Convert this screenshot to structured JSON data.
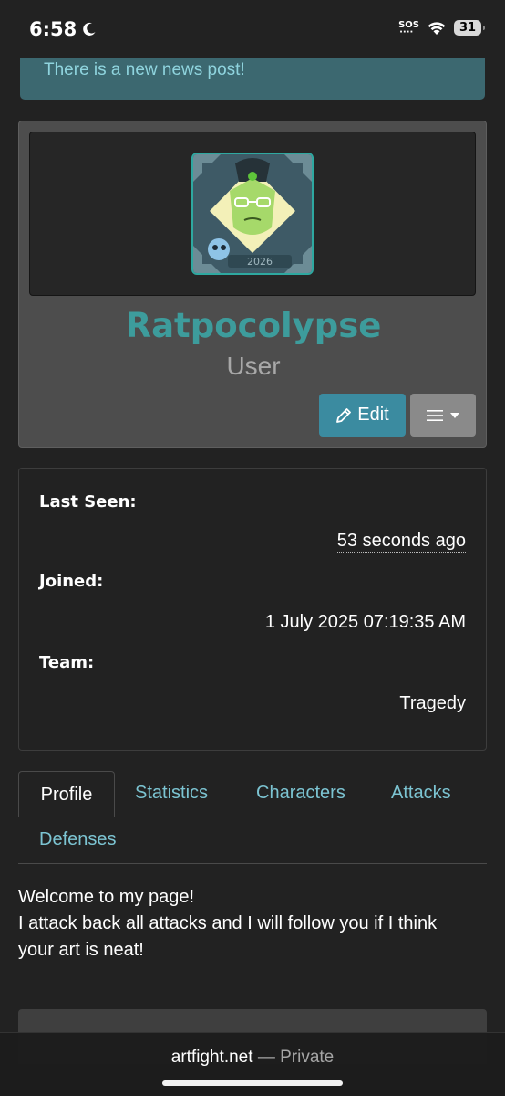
{
  "status_bar": {
    "time": "6:58",
    "sos": "SOS",
    "battery": "31"
  },
  "news": {
    "text": "There is a new news post!"
  },
  "profile": {
    "username": "Ratpocolypse",
    "role": "User",
    "edit_label": "Edit",
    "avatar_year": "2026"
  },
  "info": {
    "last_seen_label": "Last Seen:",
    "last_seen_value": "53 seconds ago",
    "joined_label": "Joined:",
    "joined_value": "1 July 2025 07:19:35 AM",
    "team_label": "Team:",
    "team_value": "Tragedy"
  },
  "tabs": [
    {
      "label": "Profile",
      "active": true
    },
    {
      "label": "Statistics"
    },
    {
      "label": "Characters"
    },
    {
      "label": "Attacks"
    },
    {
      "label": "Defenses"
    }
  ],
  "about": {
    "line1": "Welcome to my page!",
    "line2": "I attack back all attacks and I will follow you if I think your art is neat!"
  },
  "browser": {
    "domain": "artfight.net",
    "separator": "—",
    "mode": "Private"
  },
  "colors": {
    "accent": "#3b8ba0",
    "username": "#3d9c9c",
    "tab_link": "#7cc4d2",
    "news_bg": "#3c6870"
  }
}
